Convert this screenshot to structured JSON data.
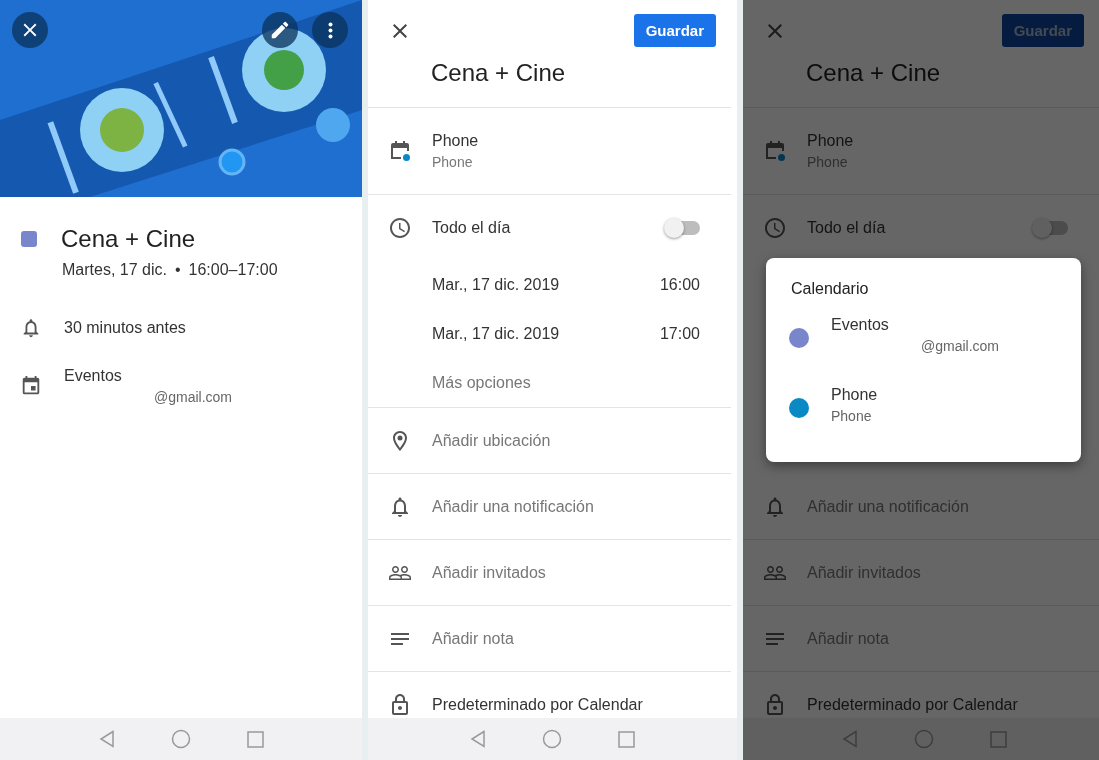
{
  "event_details": {
    "title": "Cena + Cine",
    "color": "#7986cb",
    "date": "Martes, 17 dic.",
    "separator": "•",
    "time": "16:00–17:00",
    "reminder": "30 minutos antes",
    "calendar": {
      "name": "Eventos",
      "account": "@gmail.com"
    }
  },
  "event_editor": {
    "save_button": "Guardar",
    "title": "Cena + Cine",
    "calendar": {
      "name": "Phone",
      "account": "Phone"
    },
    "all_day": {
      "label": "Todo el día",
      "on": false
    },
    "start": {
      "date": "Mar., 17 dic. 2019",
      "time": "16:00"
    },
    "end": {
      "date": "Mar., 17 dic. 2019",
      "time": "17:00"
    },
    "more_options": "Más opciones",
    "rows": [
      {
        "kind": "location",
        "label": "Añadir ubicación"
      },
      {
        "kind": "notification",
        "label": "Añadir una notificación"
      },
      {
        "kind": "guests",
        "label": "Añadir invitados"
      },
      {
        "kind": "note",
        "label": "Añadir nota"
      },
      {
        "kind": "visibility",
        "label": "Predeterminado por Calendar"
      }
    ]
  },
  "editor_with_dialog": {
    "save_button": "Guardar",
    "title": "Cena + Cine",
    "calendar": {
      "name": "Phone",
      "account": "Phone"
    },
    "all_day": {
      "label": "Todo el día",
      "on": false
    },
    "rows": [
      {
        "kind": "notification",
        "label": "Añadir una notificación"
      },
      {
        "kind": "guests",
        "label": "Añadir invitados"
      },
      {
        "kind": "note",
        "label": "Añadir nota"
      },
      {
        "kind": "visibility",
        "label": "Predeterminado por Calendar"
      }
    ],
    "dialog": {
      "title": "Calendario",
      "options": [
        {
          "name": "Eventos",
          "account": "@gmail.com",
          "color": "#7986cb"
        },
        {
          "name": "Phone",
          "account": "Phone",
          "color": "#0a8ac4"
        }
      ]
    }
  }
}
